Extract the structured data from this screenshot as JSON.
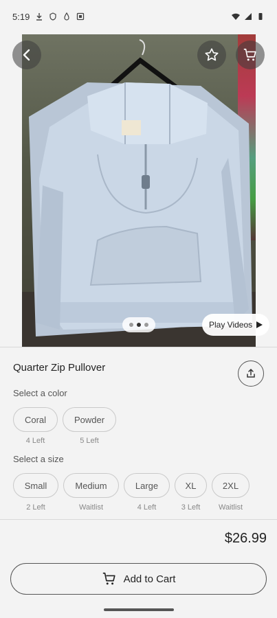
{
  "status_bar": {
    "time": "5:19"
  },
  "product": {
    "title": "Quarter Zip Pullover",
    "price": "$26.99"
  },
  "media": {
    "play_videos_label": "Play Videos",
    "pager_total": 3,
    "pager_active": 2
  },
  "color_section": {
    "label": "Select a color",
    "options": [
      {
        "name": "Coral",
        "availability": "4 Left"
      },
      {
        "name": "Powder",
        "availability": "5 Left"
      }
    ]
  },
  "size_section": {
    "label": "Select a size",
    "options": [
      {
        "name": "Small",
        "availability": "2 Left"
      },
      {
        "name": "Medium",
        "availability": "Waitlist"
      },
      {
        "name": "Large",
        "availability": "4 Left"
      },
      {
        "name": "XL",
        "availability": "3 Left"
      },
      {
        "name": "2XL",
        "availability": "Waitlist"
      }
    ]
  },
  "actions": {
    "add_to_cart_label": "Add to Cart"
  },
  "icons": {
    "back": "back-arrow-icon",
    "favorite": "star-icon",
    "cart": "cart-icon",
    "share": "share-icon",
    "play": "play-icon"
  }
}
